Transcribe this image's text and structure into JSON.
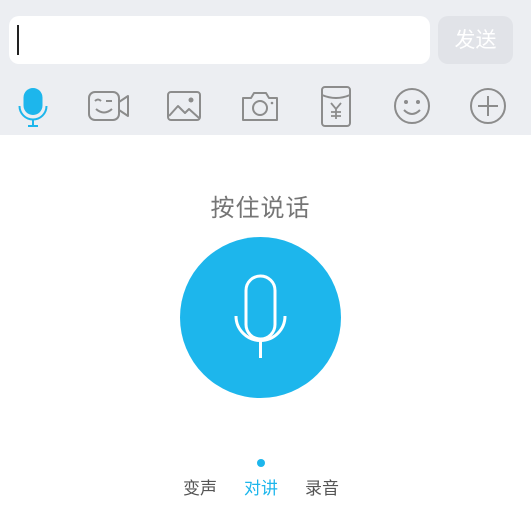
{
  "input": {
    "value": "",
    "send_label": "发送"
  },
  "toolbar": {
    "items": [
      {
        "icon": "microphone-icon",
        "active": true
      },
      {
        "icon": "video-chat-icon",
        "active": false
      },
      {
        "icon": "image-icon",
        "active": false
      },
      {
        "icon": "camera-icon",
        "active": false
      },
      {
        "icon": "red-packet-icon",
        "active": false
      },
      {
        "icon": "emoji-icon",
        "active": false
      },
      {
        "icon": "plus-icon",
        "active": false
      }
    ]
  },
  "voice": {
    "hint": "按住说话",
    "modes": [
      {
        "label": "变声",
        "active": false
      },
      {
        "label": "对讲",
        "active": true
      },
      {
        "label": "录音",
        "active": false
      }
    ]
  },
  "colors": {
    "accent": "#1db6ec",
    "icon_gray": "#8c8c8c",
    "toolbar_bg": "#eceef2",
    "send_bg": "#e1e3e8"
  }
}
